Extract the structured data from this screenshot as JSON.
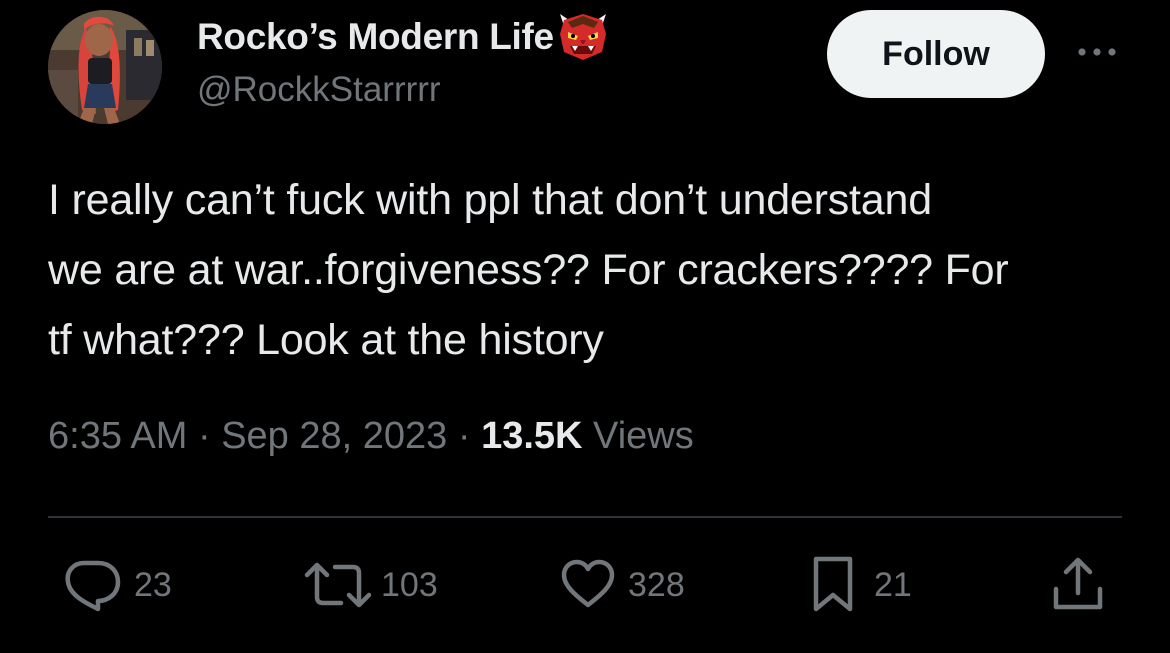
{
  "user": {
    "display_name": "Rocko’s Modern Life",
    "name_emoji": "japanese-ogre-emoji",
    "handle": "@RockkStarrrrr",
    "avatar": "profile-photo"
  },
  "header": {
    "follow_label": "Follow",
    "more_icon": "ellipsis-icon"
  },
  "tweet": {
    "lines": [
      "I really can’t fuck with ppl that don’t understand",
      "we are at war..forgiveness?? For crackers???? For",
      "tf what??? Look at the history"
    ]
  },
  "meta": {
    "time": "6:35 AM",
    "separator": "·",
    "date": "Sep 28, 2023",
    "views_count": "13.5K",
    "views_label": "Views"
  },
  "actions": {
    "replies": "23",
    "reposts": "103",
    "likes": "328",
    "bookmarks": "21"
  },
  "colors": {
    "background": "#000000",
    "text_primary": "#e7e9ea",
    "text_secondary": "#71767b",
    "divider": "#2f3336",
    "follow_bg": "#eff3f4",
    "follow_text": "#0f1419"
  }
}
